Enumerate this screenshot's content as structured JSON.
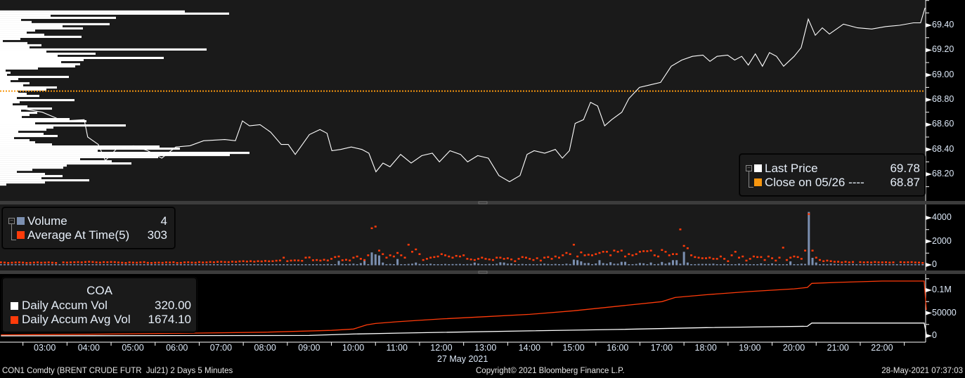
{
  "colors": {
    "panel_bg": "#1a1a1a",
    "axis_bg": "#000000",
    "price_line": "#ffffff",
    "close_line": "#f7960f",
    "volume_bar": "#7b8fb0",
    "avg_marker": "#ff3b0a",
    "accum_vol": "#ffffff",
    "accum_avg": "#ff3b0a",
    "text": "#dce8f7"
  },
  "price_legend": {
    "items": [
      {
        "label": "Last Price",
        "value": "69.78",
        "color": "#ffffff"
      },
      {
        "label": "Close on 05/26 ----",
        "value": "68.87",
        "color": "#f7960f"
      }
    ]
  },
  "volume_legend": {
    "items": [
      {
        "label": "Volume",
        "value": "4",
        "color": "#7b8fb0"
      },
      {
        "label": "Average At Time(5)",
        "value": "303",
        "color": "#ff3b0a"
      }
    ]
  },
  "accum_legend": {
    "title": "COA",
    "items": [
      {
        "label": "Daily Accum Vol",
        "value": "320.00",
        "color": "#ffffff"
      },
      {
        "label": "Daily Accum Avg Vol",
        "value": "1674.10",
        "color": "#ff3b0a"
      }
    ]
  },
  "footer": {
    "security": "CON1 Comdty (BRENT CRUDE FUTR  Jul21) 2 Days 5 Minutes",
    "date_label": "27 May 2021",
    "copyright": "Copyright© 2021 Bloomberg Finance L.P.",
    "timestamp": "28-May-2021 07:37:03"
  },
  "chart_data": [
    {
      "type": "line",
      "title": "Last Price",
      "x_unit": "hour of day",
      "xlim": [
        2,
        23
      ],
      "ylim": [
        67.985,
        69.604
      ],
      "yticks": [
        "68.20",
        "68.40",
        "68.60",
        "68.80",
        "69.00",
        "69.20",
        "69.40"
      ],
      "ytick_values": [
        68.2,
        68.4,
        68.6,
        68.8,
        69.0,
        69.2,
        69.4
      ],
      "close_reference": 68.87,
      "x": [
        2.46,
        2.94,
        3.41,
        3.89,
        3.97,
        4.21,
        4.37,
        4.61,
        5.01,
        5.33,
        5.65,
        5.97,
        6.29,
        6.6,
        7.08,
        7.32,
        7.48,
        7.64,
        7.88,
        8.12,
        8.36,
        8.52,
        8.68,
        9.0,
        9.24,
        9.4,
        9.51,
        9.71,
        9.95,
        10.19,
        10.35,
        10.51,
        10.67,
        10.83,
        11.07,
        11.31,
        11.55,
        11.79,
        11.95,
        12.19,
        12.43,
        12.59,
        12.82,
        13.06,
        13.3,
        13.54,
        13.78,
        13.94,
        14.1,
        14.34,
        14.58,
        14.74,
        14.9,
        15.03,
        15.22,
        15.38,
        15.54,
        15.7,
        15.86,
        16.09,
        16.25,
        16.49,
        16.73,
        16.97,
        17.21,
        17.45,
        17.69,
        17.93,
        18.09,
        18.25,
        18.49,
        18.65,
        18.81,
        18.96,
        19.12,
        19.28,
        19.44,
        19.6,
        19.76,
        20.0,
        20.16,
        20.32,
        20.48,
        20.64,
        20.8,
        21.12,
        21.44,
        21.76,
        22.08,
        22.39,
        22.71,
        22.87,
        22.97
      ],
      "y": [
        68.73,
        68.7,
        68.63,
        68.64,
        68.5,
        68.44,
        68.31,
        68.4,
        68.43,
        68.39,
        68.33,
        68.42,
        68.43,
        68.47,
        68.48,
        68.47,
        68.63,
        68.59,
        68.6,
        68.54,
        68.44,
        68.44,
        68.36,
        68.52,
        68.56,
        68.53,
        68.39,
        68.4,
        68.42,
        68.4,
        68.37,
        68.22,
        68.29,
        68.26,
        68.36,
        68.29,
        68.35,
        68.37,
        68.3,
        68.39,
        68.36,
        68.3,
        68.35,
        68.33,
        68.19,
        68.14,
        68.19,
        68.36,
        68.39,
        68.37,
        68.4,
        68.33,
        68.39,
        68.61,
        68.64,
        68.78,
        68.75,
        68.59,
        68.64,
        68.7,
        68.81,
        68.9,
        68.92,
        68.94,
        69.07,
        69.12,
        69.15,
        69.16,
        69.11,
        69.15,
        69.16,
        69.12,
        69.15,
        69.08,
        69.17,
        69.07,
        69.18,
        69.15,
        69.07,
        69.15,
        69.22,
        69.45,
        69.32,
        69.38,
        69.33,
        69.41,
        69.38,
        69.37,
        69.39,
        69.4,
        69.42,
        69.42,
        69.54
      ],
      "volume_profile": {
        "top_price": 69.52,
        "price_step": -0.017,
        "values": [
          263,
          326,
          72,
          165,
          30,
          45,
          156,
          89,
          118,
          50,
          38,
          63,
          116,
          29,
          4,
          39,
          59,
          42,
          294,
          66,
          136,
          82,
          233,
          119,
          87,
          114,
          107,
          54,
          8,
          15,
          10,
          98,
          26,
          15,
          42,
          33,
          81,
          66,
          26,
          38,
          56,
          24,
          106,
          28,
          18,
          39,
          74,
          30,
          53,
          42,
          31,
          99,
          123,
          50,
          179,
          76,
          66,
          26,
          62,
          82,
          20,
          42,
          50,
          74,
          227,
          256,
          139,
          355,
          327,
          225,
          114,
          159,
          187,
          95,
          90,
          46,
          24,
          64,
          89,
          59,
          127,
          64,
          9
        ]
      }
    },
    {
      "type": "bar",
      "title": "Volume / Average At Time(5)",
      "x_start_hour": 2,
      "interval_minutes": 5,
      "ylim": [
        0,
        4800
      ],
      "yticks": [
        "0",
        "2000",
        "4000"
      ],
      "ytick_values": [
        0,
        2000,
        4000
      ],
      "series": [
        {
          "name": "Volume",
          "values": [
            30,
            40,
            30,
            50,
            40,
            40,
            30,
            40,
            40,
            30,
            40,
            40,
            40,
            30,
            50,
            40,
            40,
            60,
            40,
            40,
            30,
            40,
            50,
            40,
            40,
            30,
            40,
            40,
            50,
            40,
            40,
            30,
            40,
            50,
            40,
            40,
            40,
            40,
            30,
            0,
            40,
            50,
            40,
            40,
            0,
            30,
            40,
            40,
            40,
            50,
            40,
            50,
            40,
            60,
            40,
            50,
            40,
            40,
            60,
            40,
            40,
            60,
            40,
            40,
            50,
            40,
            50,
            40,
            60,
            40,
            40,
            50,
            40,
            50,
            40,
            60,
            40,
            50,
            60,
            40,
            50,
            40,
            60,
            50,
            60,
            40,
            50,
            60,
            60,
            80,
            60,
            60,
            340,
            90,
            60,
            80,
            100,
            60,
            150,
            400,
            60,
            1060,
            900,
            800,
            200,
            60,
            80,
            60,
            500,
            60,
            60,
            80,
            100,
            200,
            80,
            60,
            60,
            100,
            60,
            60,
            60,
            80,
            60,
            70,
            70,
            80,
            60,
            70,
            80,
            200,
            100,
            60,
            60,
            80,
            60,
            90,
            220,
            200,
            100,
            120,
            60,
            60,
            80,
            60,
            70,
            60,
            60,
            80,
            100,
            70,
            60,
            80,
            60,
            60,
            100,
            70,
            450,
            400,
            300,
            150,
            160,
            60,
            120,
            400,
            150,
            100,
            230,
            100,
            100,
            260,
            260,
            60,
            60,
            80,
            160,
            130,
            60,
            200,
            60,
            80,
            250,
            100,
            200,
            400,
            400,
            100,
            1110,
            200,
            60,
            60,
            80,
            80,
            80,
            80,
            100,
            60,
            60,
            80,
            60,
            60,
            60,
            100,
            60,
            80,
            60,
            40,
            60,
            120,
            60,
            60,
            120,
            60,
            60,
            40,
            60,
            300,
            60,
            60,
            100,
            80,
            4500,
            600,
            200,
            60,
            80,
            60,
            100,
            80,
            60,
            60,
            60,
            40,
            80,
            60,
            40,
            40,
            60,
            60,
            60,
            40,
            60,
            40,
            40,
            60,
            60,
            40,
            40,
            60,
            40,
            60,
            40,
            60
          ]
        },
        {
          "name": "Average At Time(5)",
          "values": [
            200,
            180,
            150,
            170,
            190,
            200,
            180,
            150,
            160,
            180,
            200,
            170,
            180,
            200,
            170,
            150,
            0,
            200,
            180,
            200,
            210,
            220,
            200,
            230,
            250,
            230,
            200,
            180,
            220,
            210,
            230,
            220,
            190,
            170,
            150,
            200,
            180,
            170,
            200,
            220,
            160,
            150,
            170,
            180,
            160,
            200,
            190,
            210,
            150,
            160,
            200,
            210,
            180,
            170,
            220,
            190,
            200,
            230,
            210,
            240,
            250,
            230,
            220,
            260,
            240,
            280,
            300,
            270,
            300,
            260,
            300,
            280,
            320,
            290,
            300,
            340,
            360,
            600,
            300,
            350,
            370,
            360,
            330,
            600,
            620,
            380,
            400,
            350,
            420,
            360,
            500,
            650,
            700,
            380,
            420,
            360,
            600,
            700,
            500,
            400,
            800,
            3100,
            3240,
            1200,
            900,
            600,
            800,
            700,
            1000,
            800,
            600,
            1700,
            1100,
            1300,
            900,
            400,
            500,
            600,
            650,
            700,
            900,
            800,
            700,
            600,
            750,
            700,
            800,
            500,
            450,
            400,
            500,
            600,
            500,
            450,
            400,
            600,
            600,
            500,
            550,
            450,
            300,
            500,
            650,
            600,
            500,
            400,
            550,
            350,
            600,
            650,
            500,
            700,
            600,
            800,
            1000,
            900,
            1700,
            700,
            1050,
            800,
            850,
            800,
            900,
            1000,
            1100,
            1100,
            800,
            1200,
            1100,
            1200,
            700,
            900,
            800,
            900,
            1100,
            1150,
            1150,
            1200,
            800,
            700,
            1250,
            1100,
            800,
            900,
            900,
            3000,
            1600,
            1400,
            800,
            650,
            600,
            550,
            550,
            600,
            500,
            500,
            700,
            500,
            300,
            800,
            1100,
            600,
            700,
            350,
            500,
            700,
            650,
            650,
            400,
            700,
            550,
            350,
            600,
            1450,
            400,
            600,
            700,
            650,
            500,
            1200,
            4300,
            1200,
            600,
            400,
            300,
            350,
            300,
            250,
            250,
            200,
            250,
            200,
            230,
            0,
            220,
            200,
            210,
            190,
            230,
            200,
            200,
            210,
            180,
            200,
            0,
            220,
            200,
            210,
            220,
            190,
            180,
            150
          ]
        }
      ]
    },
    {
      "type": "line",
      "title": "COA",
      "ylim": [
        0,
        130000
      ],
      "yticks": [
        "0",
        "50000",
        "0.1M"
      ],
      "ytick_values": [
        0,
        50000,
        100000
      ],
      "xticks": [
        "03:00",
        "04:00",
        "05:00",
        "06:00",
        "07:00",
        "08:00",
        "09:00",
        "10:00",
        "11:00",
        "12:00",
        "13:00",
        "14:00",
        "15:00",
        "16:00",
        "17:00",
        "18:00",
        "19:00",
        "20:00",
        "21:00",
        "22:00"
      ],
      "xtick_values": [
        3,
        4,
        5,
        6,
        7,
        8,
        9,
        10,
        11,
        12,
        13,
        14,
        15,
        16,
        17,
        18,
        19,
        20,
        21,
        22
      ],
      "series": [
        {
          "name": "Daily Accum Avg Vol",
          "x": [
            2,
            4,
            6,
            8,
            9.5,
            10,
            10.3,
            10.5,
            11,
            12,
            13,
            14,
            15,
            16,
            17,
            17.3,
            18,
            19,
            20,
            20.3,
            20.4,
            21,
            22,
            22.95,
            23
          ],
          "y": [
            2000,
            3500,
            5500,
            8000,
            12000,
            15000,
            24000,
            27000,
            31000,
            37000,
            42000,
            47000,
            55000,
            65000,
            75000,
            84000,
            90000,
            97000,
            103000,
            106000,
            115000,
            117000,
            120000,
            120000,
            57000
          ]
        },
        {
          "name": "Daily Accum Vol",
          "x": [
            2,
            9,
            10,
            11,
            14,
            16,
            18,
            20.3,
            20.4,
            22.95,
            23
          ],
          "y": [
            0,
            1000,
            4000,
            6000,
            11000,
            14000,
            18000,
            21000,
            28000,
            28000,
            4000
          ]
        }
      ]
    }
  ]
}
